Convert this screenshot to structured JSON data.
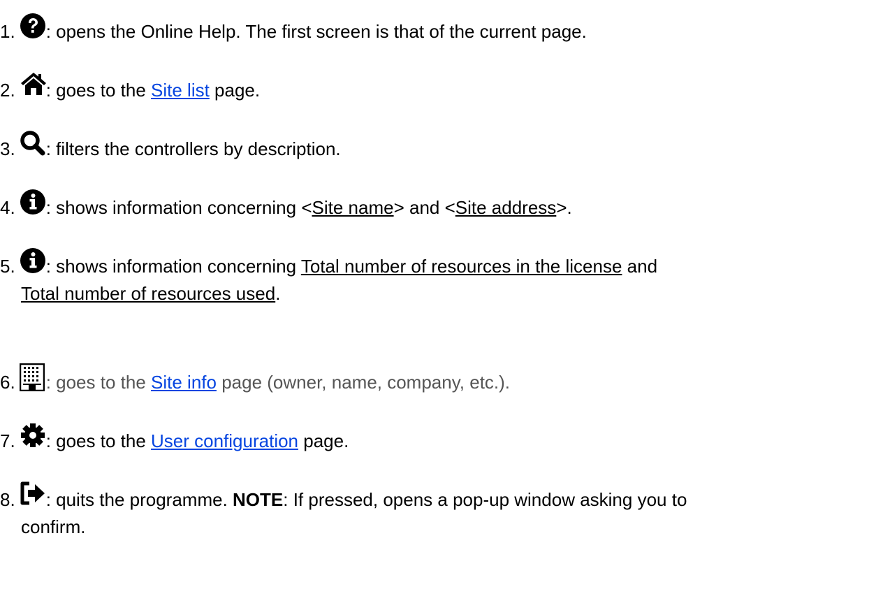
{
  "items": [
    {
      "num": "1.",
      "icon": "question-circle-icon",
      "text": ": opens the Online Help. The first screen is that of the current page."
    },
    {
      "num": "2.",
      "icon": "home-icon",
      "pre": ": goes to the ",
      "link": "Site list",
      "post": " page."
    },
    {
      "num": "3.",
      "icon": "search-icon",
      "text": ": filters the controllers by description."
    },
    {
      "num": "4.",
      "icon": "info-circle-icon",
      "pre": ": shows information concerning <",
      "u1": "Site name",
      "mid": "> and <",
      "u2": "Site address",
      "post": ">."
    },
    {
      "num": "5.",
      "icon": "info-circle-icon",
      "pre": ": shows information concerning ",
      "u1": "Total number of resources in the license",
      "mid": " and",
      "u2": "Total number of resources used",
      "post": "."
    },
    {
      "num": "6.",
      "icon": "building-icon",
      "pre": ": goes to the ",
      "link": "Site info",
      "post": " page (owner, name, company, etc.)."
    },
    {
      "num": "7.",
      "icon": "gear-icon",
      "pre": ": goes to the ",
      "link": "User configuration",
      "post": " page."
    },
    {
      "num": "8.",
      "icon": "sign-out-icon",
      "pre": ": quits the programme. ",
      "bold": "NOTE",
      "post": ": If pressed, opens a pop-up window asking you to",
      "post2": "confirm."
    }
  ],
  "colors": {
    "text": "#000000",
    "link": "#0645e0",
    "grey_text": "#555555"
  }
}
